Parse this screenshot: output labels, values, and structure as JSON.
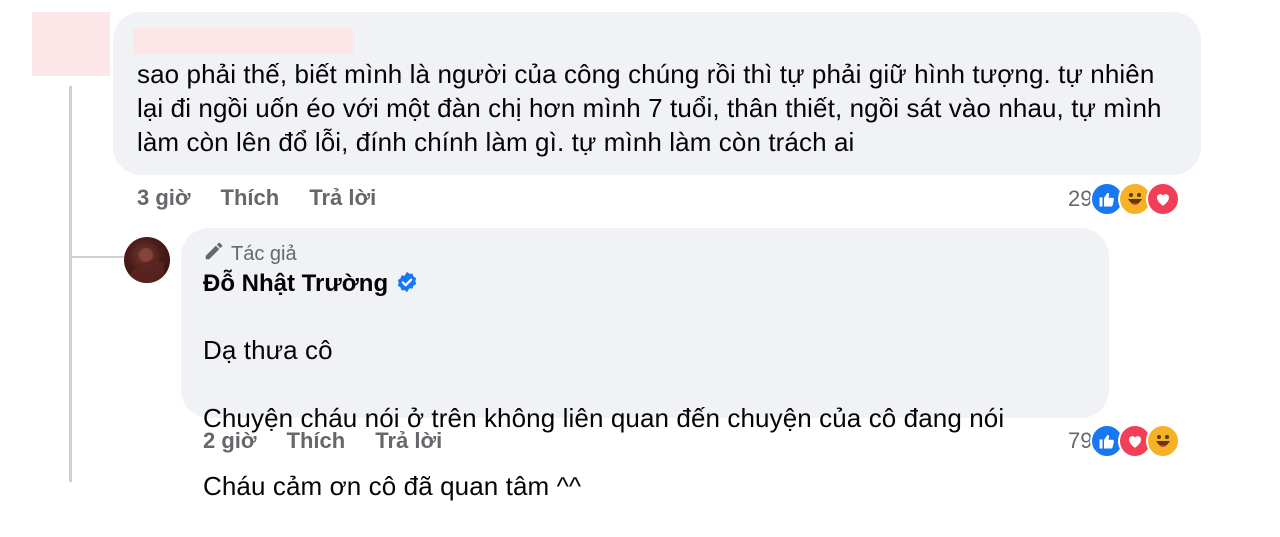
{
  "comment_1": {
    "text": "sao phải thế, biết mình là người của công chúng rồi thì tự phải giữ hình tượng. tự nhiên lại đi ngồi uốn éo với một đàn chị hơn mình 7 tuổi, thân thiết, ngồi sát vào nhau, tự mình làm còn lên đổ lỗi, đính chính làm gì. tự mình làm còn trách ai",
    "time": "3 giờ",
    "like_label": "Thích",
    "reply_label": "Trả lời",
    "reaction_count": "29",
    "reactions": [
      "like-icon",
      "haha-icon",
      "love-icon"
    ]
  },
  "comment_2": {
    "author_badge": "Tác giả",
    "author_name": "Đỗ Nhật Trường",
    "verified": true,
    "text_lines": [
      "Dạ thưa cô",
      "Chuyện cháu nói ở trên không liên quan đến chuyện của cô đang nói",
      "Cháu cảm ơn cô đã quan tâm ^^"
    ],
    "time": "2 giờ",
    "like_label": "Thích",
    "reply_label": "Trả lời",
    "reaction_count": "79",
    "reactions": [
      "like-icon",
      "love-icon",
      "haha-icon"
    ]
  },
  "colors": {
    "bubble_bg": "#f0f2f5",
    "secondary_text": "#65676b",
    "like_blue": "#1877f2",
    "love_red": "#f33e58",
    "haha_yellow": "#f7b125",
    "verified_blue": "#1877f2"
  }
}
